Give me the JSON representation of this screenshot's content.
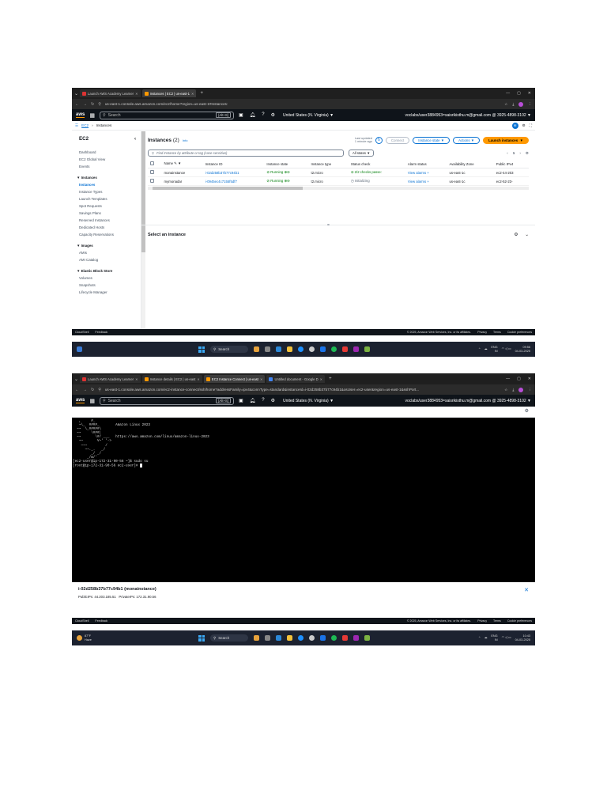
{
  "s1": {
    "tabs": [
      "Launch AWS Academy Learner",
      "Instances | EC2 | us-east-1"
    ],
    "url": "us-east-1.console.aws.amazon.com/ec2/home?region=us-east-1#Instances:",
    "aws": {
      "logo": "aws",
      "search_placeholder": "Search",
      "shortcut": "[Alt+S]",
      "region": "United States (N. Virginia) ▼",
      "account": "voclabs/user3884953=saisrikisthu.m@gmail.com @ 3925-4898-3102 ▼"
    },
    "breadcrumb": [
      "EC2",
      "Instances"
    ],
    "sidebar": {
      "title": "EC2",
      "items": [
        "Dashboard",
        "EC2 Global View",
        "Events"
      ],
      "instances_header": "▼ Instances",
      "instances_items": [
        "Instances",
        "Instance Types",
        "Launch Templates",
        "Spot Requests",
        "Savings Plans",
        "Reserved Instances",
        "Dedicated Hosts",
        "Capacity Reservations"
      ],
      "images_header": "▼ Images",
      "images_items": [
        "AMIs",
        "AMI Catalog"
      ],
      "ebs_header": "▼ Elastic Block Store",
      "ebs_items": [
        "Volumes",
        "Snapshots",
        "Lifecycle Manager"
      ]
    },
    "header": {
      "title": "Instances",
      "count": "(2)",
      "info": "Info",
      "last_updated_1": "Last updated",
      "last_updated_2": "1 minute ago",
      "connect": "Connect",
      "instance_state": "Instance state ▼",
      "actions": "Actions ▼",
      "launch": "Launch instances",
      "launch_arrow": "▼"
    },
    "filter": {
      "placeholder": "Find Instance by attribute or tag (case-sensitive)",
      "states": "All states ▼",
      "page": "1"
    },
    "columns": [
      "Name",
      "Instance ID",
      "Instance state",
      "Instance type",
      "Status check",
      "Alarm status",
      "Availability Zone",
      "Public IPv4"
    ],
    "rows": [
      {
        "name": "monainstance",
        "id": "i-02d258b37b77c94b1",
        "state": "Running",
        "type": "t2.micro",
        "status": "2/2 checks passe:",
        "alarm": "View alarms +",
        "az": "us-east-1c",
        "ipv4": "ec2-44-203"
      },
      {
        "name": "mymonadar",
        "id": "i-0945ec4c7155f5df7",
        "state": "Running",
        "type": "t2.micro",
        "status": "Initializing",
        "alarm": "View alarms +",
        "az": "us-east-1c",
        "ipv4": "ec2-52-23-"
      }
    ],
    "select_instance": "Select an instance",
    "footer": {
      "cloudshell": "CloudShell",
      "feedback": "Feedback",
      "copyright": "© 2025, Amazon Web Services, Inc. or its affiliates.",
      "privacy": "Privacy",
      "terms": "Terms",
      "cookie": "Cookie preferences"
    },
    "taskbar": {
      "search": "Search",
      "lang1": "ENG",
      "lang2": "IN",
      "time": "09:56",
      "date": "04-03-2025"
    }
  },
  "s2": {
    "tabs": [
      "Launch AWS Academy Learner",
      "Instance details | EC2 | us-east",
      "EC2 Instance Connect | us-east",
      "Untitled document - Google D"
    ],
    "url": "us-east-1.console.aws.amazon.com/ec2-instance-connect/ssh/home?addressFamily=ipv4&connType=standard&instanceId=i-02d258b37b77c94b1&osUser=ec2-user&region=us-east-1&sshPort...",
    "terminal_lines": [
      "   ,     #_",
      "   ~\\_  ####_        Amazon Linux 2023",
      "  ~~  \\_#####\\",
      "  ~~     \\###|",
      "  ~~       \\#/ ___   https://aws.amazon.com/linux/amazon-linux-2023",
      "   ~~       V~' '->",
      "    ~~~         /",
      "      ~~._.   _/",
      "         _/ _/",
      "       _/m/'",
      "[ec2-user@ip-172-31-90-56 ~]$ sudo su",
      "[root@ip-172-31-90-56 ec2-user]# "
    ],
    "instance_name": "i-02d258b37b77c94b1 (monainstance)",
    "public_ip_label": "PublicIPs:",
    "public_ip": "44.203.185.51",
    "private_ip_label": "PrivateIPs:",
    "private_ip": "172.31.90.56",
    "weather_temp": "87°F",
    "weather_desc": "Haze",
    "taskbar": {
      "search": "Search",
      "lang1": "ENG",
      "lang2": "IN",
      "time": "10:43",
      "date": "04-03-2025"
    }
  },
  "colors": {
    "aws_dark": "#0f141a",
    "link": "#0972d3",
    "orange": "#ff9900",
    "running": "#037f0c"
  }
}
